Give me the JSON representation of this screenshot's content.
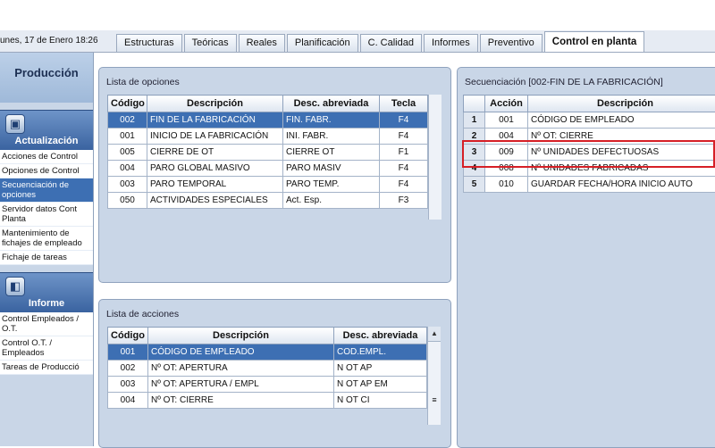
{
  "header": {
    "datetime": "unes, 17 de Enero 18:26",
    "tabs": [
      "Estructuras",
      "Teóricas",
      "Reales",
      "Planificación",
      "C. Calidad",
      "Informes",
      "Preventivo",
      "Control en planta"
    ],
    "active_tab": "Control en planta"
  },
  "sidebar": {
    "title": "Producción",
    "sections": [
      {
        "label": "Actualización",
        "icon": "save-disk-icon"
      },
      {
        "label": "Informe",
        "icon": "report-icon"
      }
    ],
    "actualizacion_items": [
      "Acciones de Control",
      "Opciones de Control",
      "Secuenciación de opciones",
      "Servidor datos Cont Planta",
      "Mantenimiento de fichajes de empleado",
      "Fichaje de tareas"
    ],
    "selected_item": "Secuenciación de opciones",
    "informe_items": [
      "Control Empleados / O.T.",
      "Control O.T. / Empleados",
      "Tareas de Producció"
    ]
  },
  "opciones": {
    "title": "Lista de opciones",
    "headers": [
      "Código",
      "Descripción",
      "Desc. abreviada",
      "Tecla"
    ],
    "rows": [
      [
        "002",
        "FIN DE LA FABRICACIÓN",
        "FIN. FABR.",
        "F4"
      ],
      [
        "001",
        "INICIO DE LA FABRICACIÓN",
        "INI. FABR.",
        "F4"
      ],
      [
        "005",
        "CIERRE DE OT",
        "CIERRE OT",
        "F1"
      ],
      [
        "004",
        "PARO GLOBAL MASIVO",
        "PARO MASIV",
        "F4"
      ],
      [
        "003",
        "PARO TEMPORAL",
        "PARO TEMP.",
        "F4"
      ],
      [
        "050",
        "ACTIVIDADES ESPECIALES",
        "Act. Esp.",
        "F3"
      ]
    ]
  },
  "acciones": {
    "title": "Lista de acciones",
    "headers": [
      "Código",
      "Descripción",
      "Desc. abreviada"
    ],
    "rows": [
      [
        "001",
        "CÓDIGO DE EMPLEADO",
        "COD.EMPL."
      ],
      [
        "002",
        "Nº OT: APERTURA",
        "N OT AP"
      ],
      [
        "003",
        "Nº OT: APERTURA / EMPL",
        "N OT AP EM"
      ],
      [
        "004",
        "Nº OT: CIERRE",
        "N OT CI"
      ]
    ]
  },
  "secuencia": {
    "title": "Secuenciación [002-FIN DE LA FABRICACIÓN]",
    "headers": [
      "",
      "Acción",
      "Descripción"
    ],
    "rows": [
      [
        "1",
        "001",
        "CÓDIGO DE EMPLEADO"
      ],
      [
        "2",
        "004",
        "Nº OT: CIERRE"
      ],
      [
        "3",
        "009",
        "Nº UNIDADES DEFECTUOSAS"
      ],
      [
        "4",
        "008",
        "Nº UNIDADES FABRICADAS"
      ],
      [
        "5",
        "010",
        "GUARDAR FECHA/HORA INICIO AUTO"
      ]
    ]
  },
  "colors": {
    "selection": "#3d6fb3",
    "highlight_border": "#d61f26",
    "panel_bg": "#c9d6e7"
  }
}
